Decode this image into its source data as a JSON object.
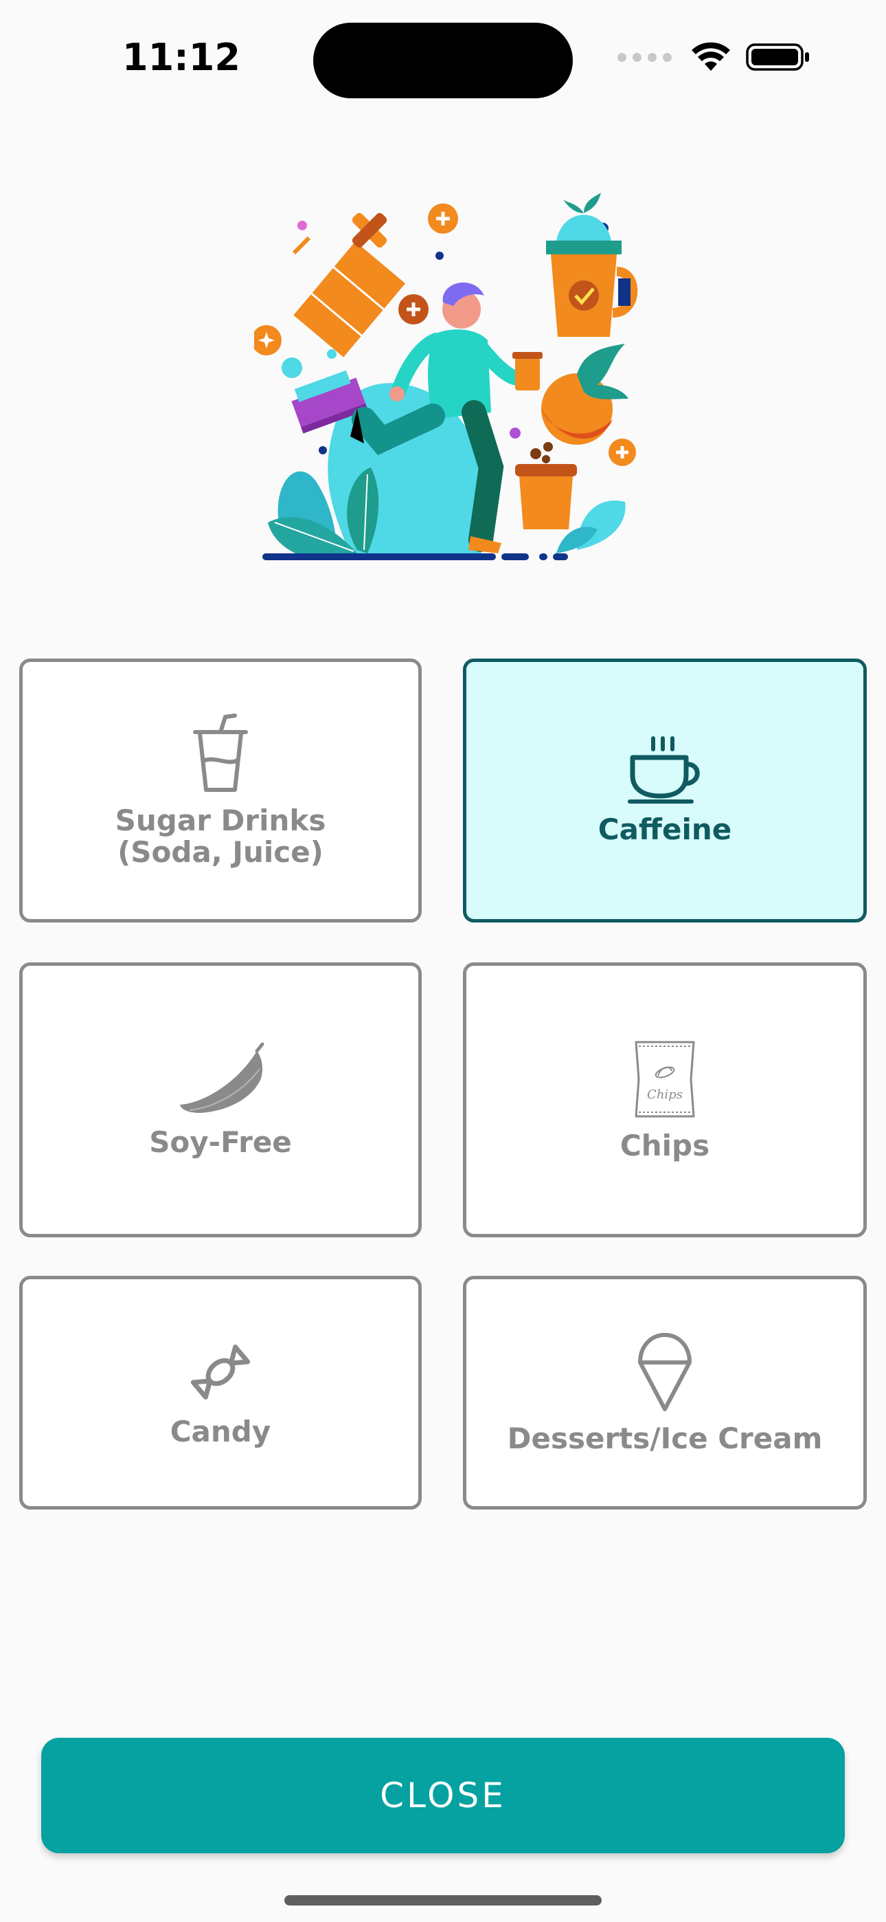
{
  "status_bar": {
    "time": "11:12"
  },
  "categories": [
    {
      "label": "Sugar Drinks\n(Soda, Juice)",
      "icon": "drink-cup-icon",
      "selected": false
    },
    {
      "label": "Caffeine",
      "icon": "coffee-cup-icon",
      "selected": true
    },
    {
      "label": "Soy-Free",
      "icon": "soy-bean-icon",
      "selected": false
    },
    {
      "label": "Chips",
      "icon": "chips-bag-icon",
      "selected": false
    },
    {
      "label": "Candy",
      "icon": "candy-icon",
      "selected": false
    },
    {
      "label": "Desserts/Ice Cream",
      "icon": "ice-cream-cone-icon",
      "selected": false
    }
  ],
  "close_button": {
    "label": "CLOSE"
  },
  "chips_bag_text": "Chips",
  "colors": {
    "accent": "#06a1a1",
    "selected_border": "#0f5b60",
    "selected_fill": "#d8fbfc",
    "tile_border": "#8a8a8a",
    "background": "#fafafa"
  }
}
